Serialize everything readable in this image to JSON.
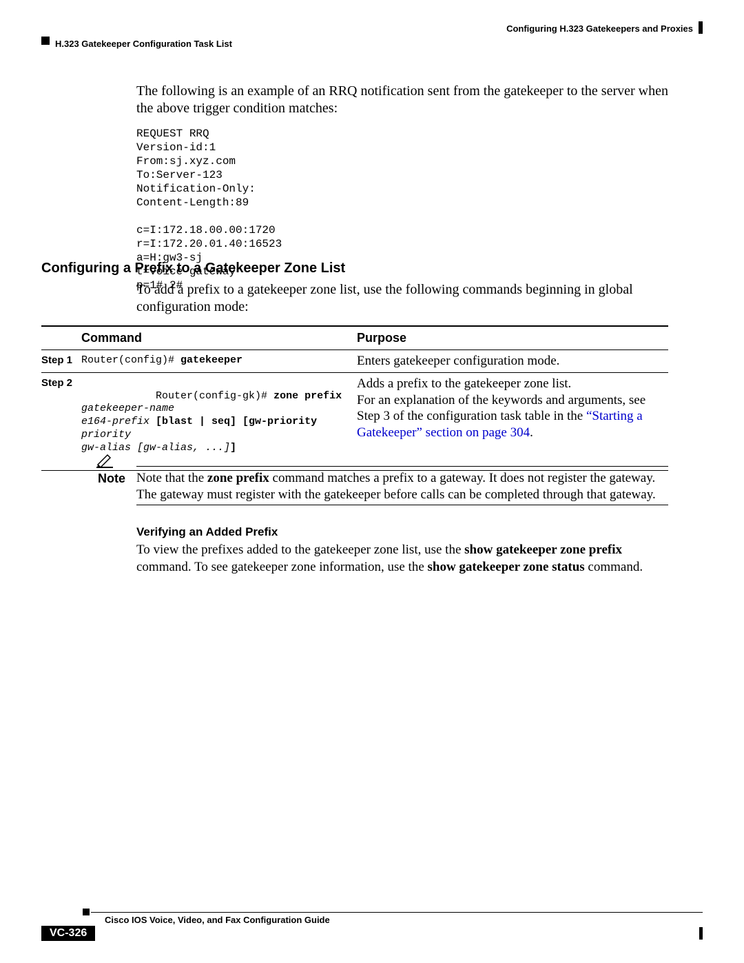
{
  "header": {
    "chapter_title": "Configuring H.323 Gatekeepers and Proxies",
    "section_title": "H.323 Gatekeeper Configuration Task List"
  },
  "intro_para": "The following is an example of an RRQ notification sent from the gatekeeper to the server when the above trigger condition matches:",
  "code_block": "REQUEST RRQ\nVersion-id:1\nFrom:sj.xyz.com\nTo:Server-123\nNotification-Only:\nContent-Length:89\n\nc=I:172.18.00.00:1720\nr=I:172.20.01.40:16523\na=H:gw3-sj\nt=voice-gateway\np=1# 2#",
  "section_heading": "Configuring a Prefix to a Gatekeeper Zone List",
  "section_intro": "To add a prefix to a gatekeeper zone list, use the following commands beginning in global configuration mode:",
  "table": {
    "head": {
      "step_blank": "",
      "cmd": "Command",
      "purpose": "Purpose"
    },
    "rows": [
      {
        "step": "Step 1",
        "cmd_prompt": "Router(config)# ",
        "cmd_bold": "gatekeeper",
        "cmd_rest": "",
        "purpose": "Enters gatekeeper configuration mode."
      },
      {
        "step": "Step 2",
        "cmd_prompt": "Router(config-gk)# ",
        "cmd_bold": "zone prefix",
        "cmd_italic1": " gatekeeper-name\ne164-prefix",
        "cmd_bold2": " [blast | seq] [gw-priority",
        "cmd_italic2": " priority\ngw-alias [gw-alias, ...]",
        "cmd_bold3": "]",
        "purpose1": "Adds a prefix to the gatekeeper zone list.",
        "purpose2": "For an explanation of the keywords and arguments, see Step 3 of the configuration task table in the ",
        "purpose_link": "“Starting a Gatekeeper” section on page 304",
        "purpose3": "."
      }
    ]
  },
  "note": {
    "label": "Note",
    "t1": "Note that the ",
    "b1": "zone prefix",
    "t2": " command matches a prefix to a gateway. It does not register the gateway. The gateway must register with the gatekeeper before calls can be completed through that gateway."
  },
  "subheading": "Verifying an Added Prefix",
  "verify_t1": "To view the prefixes added to the gatekeeper zone list, use the ",
  "verify_b1": "show gatekeeper zone prefix",
  "verify_t2": " command. To see gatekeeper zone information, use the ",
  "verify_b2": "show gatekeeper zone status",
  "verify_t3": " command.",
  "footer": {
    "guide_title": "Cisco IOS Voice, Video, and Fax Configuration Guide",
    "page_number": "VC-326"
  }
}
